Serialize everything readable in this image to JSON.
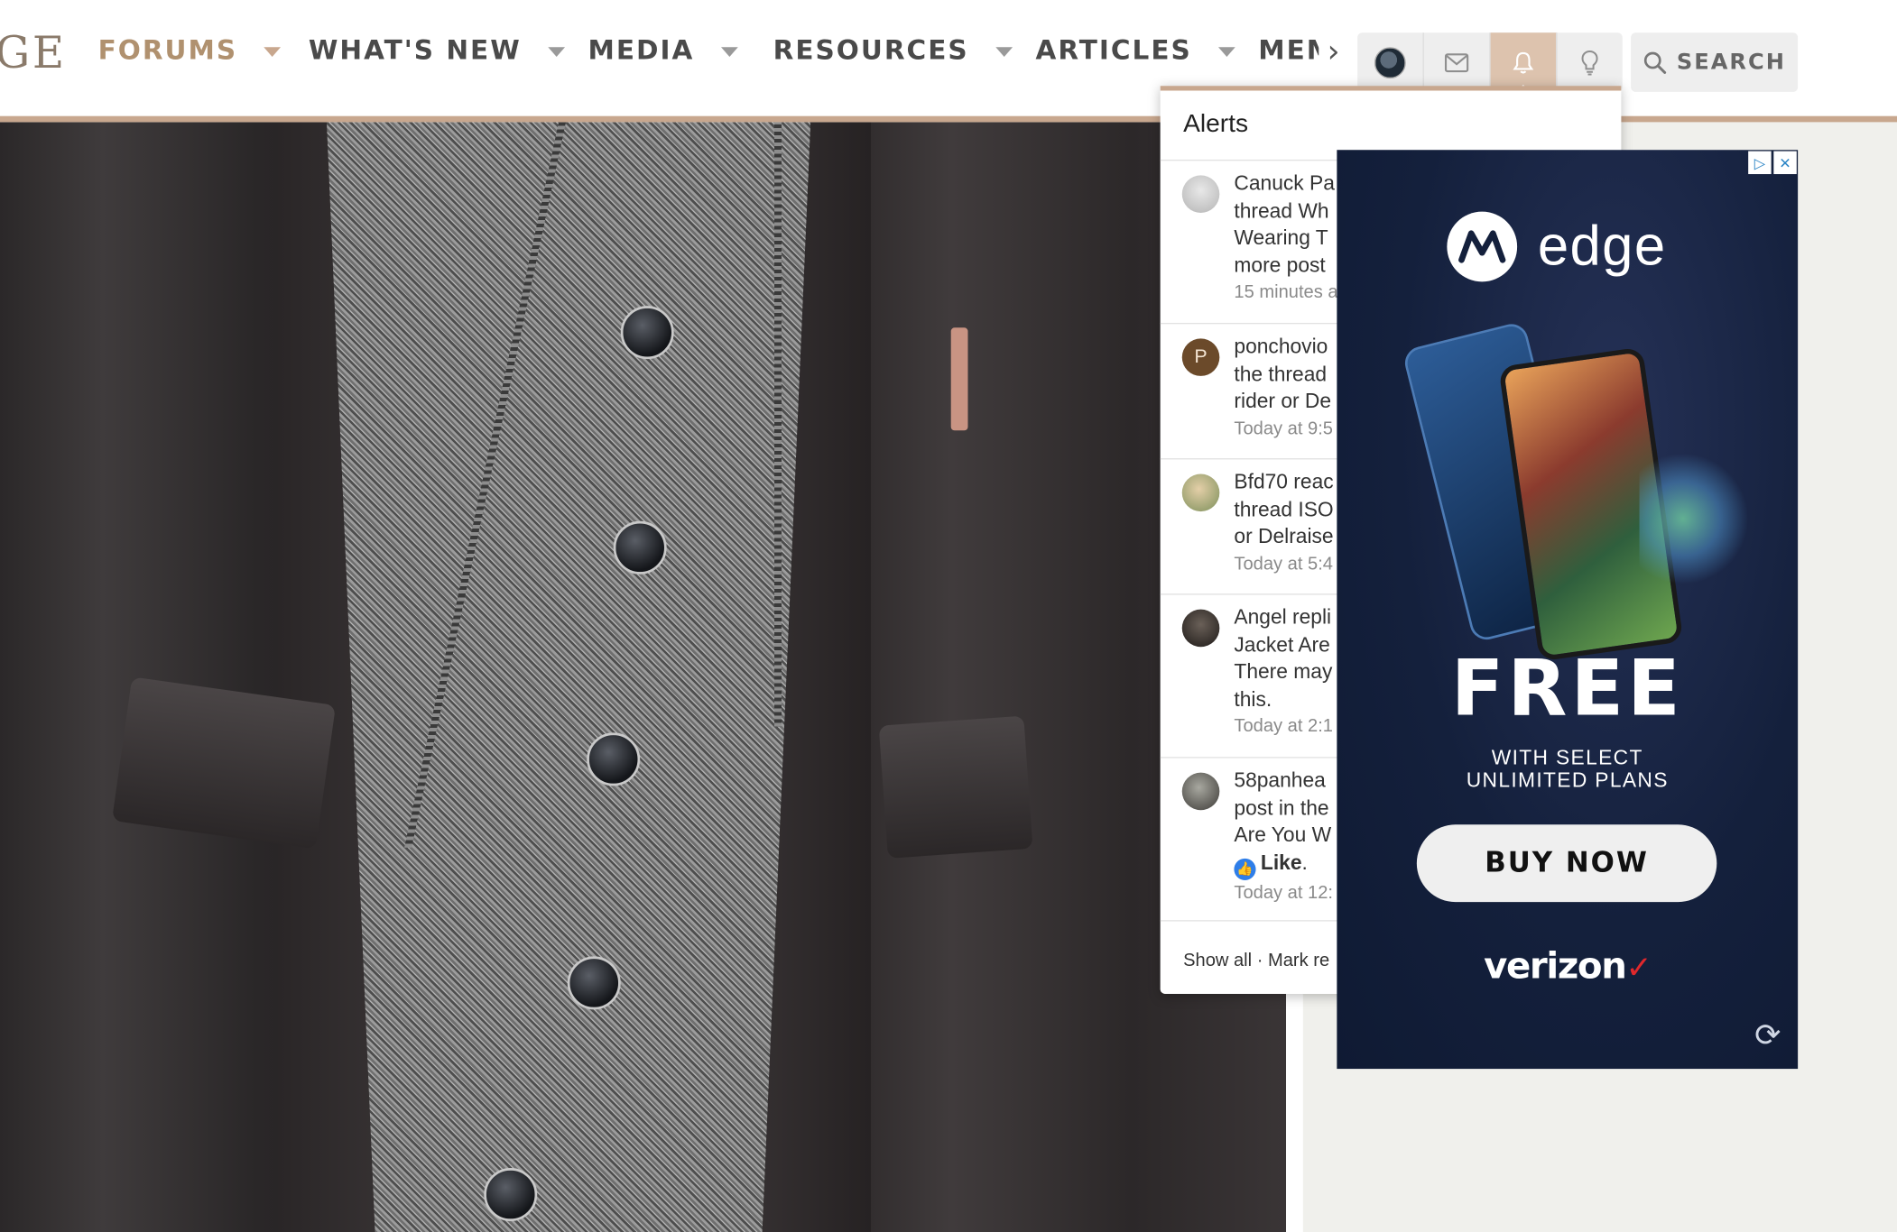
{
  "navbar": {
    "logo_fragment": "GE",
    "items": [
      {
        "label": "FORUMS",
        "active": true
      },
      {
        "label": "WHAT'S NEW"
      },
      {
        "label": "MEDIA"
      },
      {
        "label": "RESOURCES"
      },
      {
        "label": "ARTICLES"
      }
    ],
    "clipped_item": "MEMBERS",
    "more_arrow": "›",
    "icons": [
      "account-avatar",
      "envelope-icon",
      "bell-icon",
      "lightbulb-icon"
    ],
    "search_label": "SEARCH"
  },
  "alerts": {
    "title": "Alerts",
    "items": [
      {
        "lines": [
          "Canuck Pa",
          "thread Wh",
          "Wearing T",
          "more post"
        ],
        "time": "15 minutes a"
      },
      {
        "lines": [
          "ponchovio",
          "the thread",
          "rider or De"
        ],
        "time": "Today at 9:5"
      },
      {
        "lines": [
          "Bfd70 reac",
          "thread ISO",
          "or Delraise"
        ],
        "time": "Today at 5:4"
      },
      {
        "lines": [
          "Angel repli",
          "Jacket Are",
          "There may",
          "this."
        ],
        "time": "Today at 2:1"
      },
      {
        "lines": [
          "58panhea",
          "post in the",
          "Are You W"
        ],
        "like_label": "Like",
        "time": "Today at 12:"
      }
    ],
    "avatar_letter": "P",
    "footer": "Show all · Mark re"
  },
  "ad": {
    "brand": "edge",
    "headline": "FREE",
    "subline": "WITH SELECT\nUNLIMITED PLANS",
    "cta": "BUY NOW",
    "sponsor": "verizon",
    "sponsor_mark": "✓"
  },
  "colors": {
    "accent": "#c8a78e",
    "active_nav_text": "#b0916f",
    "ad_background": "#14203c"
  }
}
